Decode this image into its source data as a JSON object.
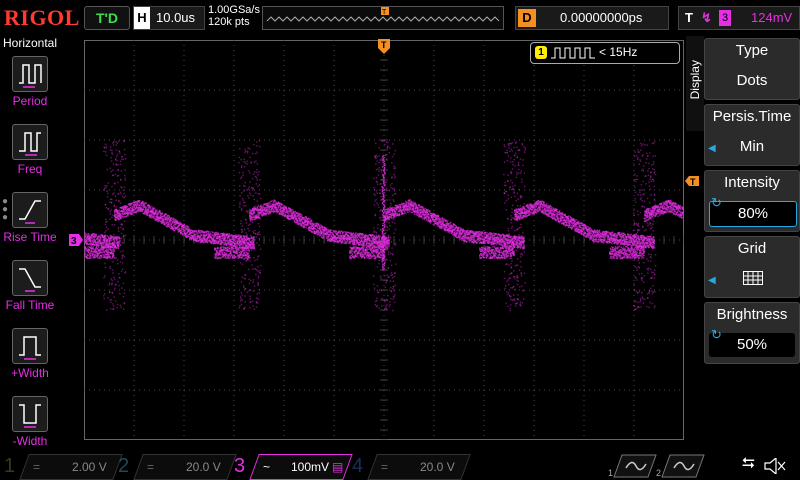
{
  "brand": "RIGOL",
  "trigger_status": "T'D",
  "horizontal": {
    "letter": "H",
    "timebase": "10.0us",
    "sample_rate": "1.00GSa/s",
    "memory_depth": "120k pts"
  },
  "delay": {
    "letter": "D",
    "value": "0.00000000ps"
  },
  "trigger": {
    "letter": "T",
    "source": "3",
    "level": "124mV"
  },
  "left_menu": {
    "title": "Horizontal",
    "items": [
      {
        "label": "Period",
        "icon": "period-icon"
      },
      {
        "label": "Freq",
        "icon": "frequency-icon"
      },
      {
        "label": "Rise Time",
        "icon": "rise-time-icon"
      },
      {
        "label": "Fall Time",
        "icon": "fall-time-icon"
      },
      {
        "label": "+Width",
        "icon": "positive-width-icon"
      },
      {
        "label": "-Width",
        "icon": "negative-width-icon"
      }
    ]
  },
  "counter": {
    "channel": "1",
    "text": "< 15Hz"
  },
  "right_menu": {
    "side_label": "Display",
    "items": [
      {
        "title": "Type",
        "value": "Dots"
      },
      {
        "title": "Persis.Time",
        "value": "Min"
      },
      {
        "title": "Intensity",
        "value": "80%"
      },
      {
        "title": "Grid",
        "value": ""
      },
      {
        "title": "Brightness",
        "value": "50%"
      }
    ]
  },
  "channels": [
    {
      "number": "1",
      "scale": "2.00 V",
      "color": "#1e1e0a",
      "active": false
    },
    {
      "number": "2",
      "scale": "20.0 V",
      "color": "#0d2a30",
      "active": false
    },
    {
      "number": "3",
      "scale": "100mV",
      "color": "#e62ee6",
      "active": true
    },
    {
      "number": "4",
      "scale": "20.0 V",
      "color": "#0a1a3a",
      "active": false
    }
  ],
  "colors": {
    "ch3": "#e62ee6",
    "grid": "#4a4a4a",
    "trigger_marker": "#f39021"
  }
}
